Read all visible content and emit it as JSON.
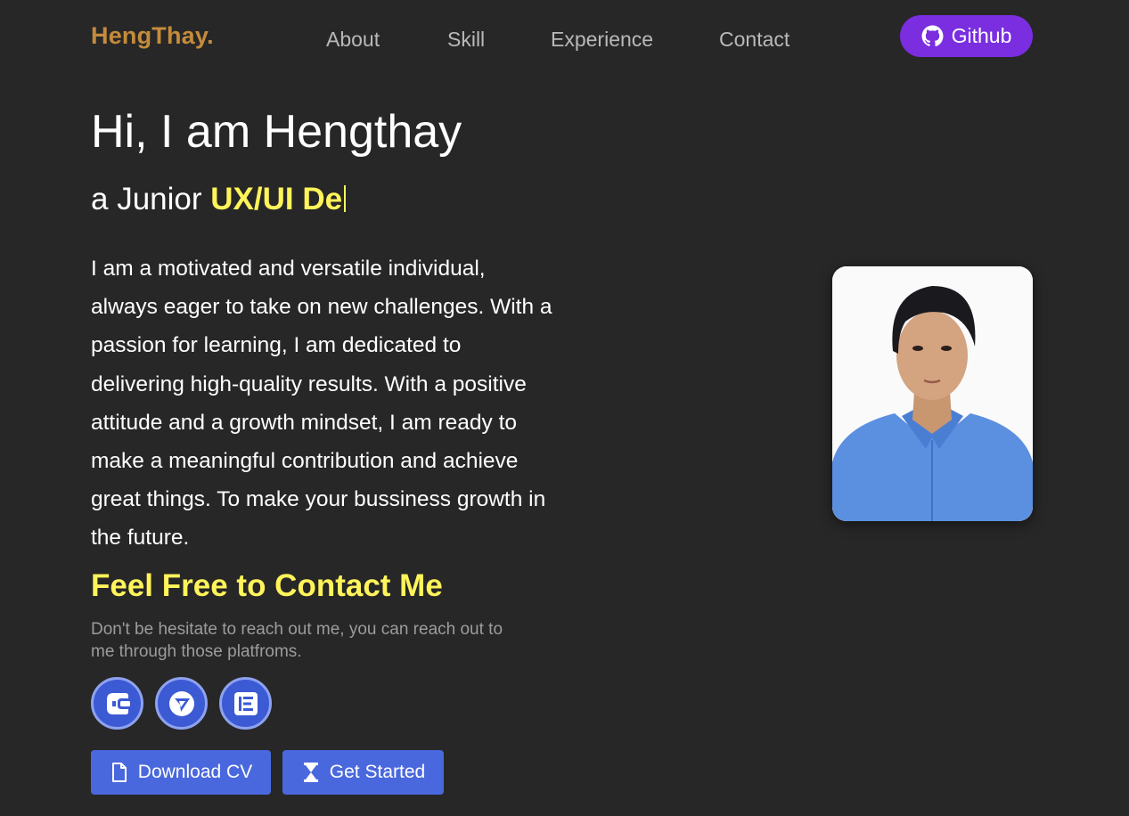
{
  "nav": {
    "brand": "HengThay.",
    "links": [
      "About",
      "Skill",
      "Experience",
      "Contact"
    ],
    "github_label": "Github"
  },
  "hero": {
    "title": "Hi, I am Hengthay",
    "role_prefix": "a Junior ",
    "role_highlight": "UX/UI De",
    "bio": "I am a motivated and versatile individual, always eager to take on new challenges. With a passion for learning, I am dedicated to delivering high-quality results. With a positive attitude and a growth mindset, I am ready to make a meaningful contribution and achieve great things. To make your bussiness growth in the future."
  },
  "contact": {
    "heading": "Feel Free to Contact Me",
    "subtext": "Don't be hesitate to reach out me, you can reach out to me through those platfroms.",
    "socials": [
      {
        "icon": "phone-icon"
      },
      {
        "icon": "telegram-icon"
      },
      {
        "icon": "email-icon"
      }
    ]
  },
  "actions": {
    "download_label": "Download CV",
    "get_started_label": "Get Started"
  },
  "colors": {
    "background": "#272727",
    "brand": "#c58b3c",
    "accent_yellow": "#fff45a",
    "github_button": "#7a2ee0",
    "primary_button": "#4a68dd"
  }
}
